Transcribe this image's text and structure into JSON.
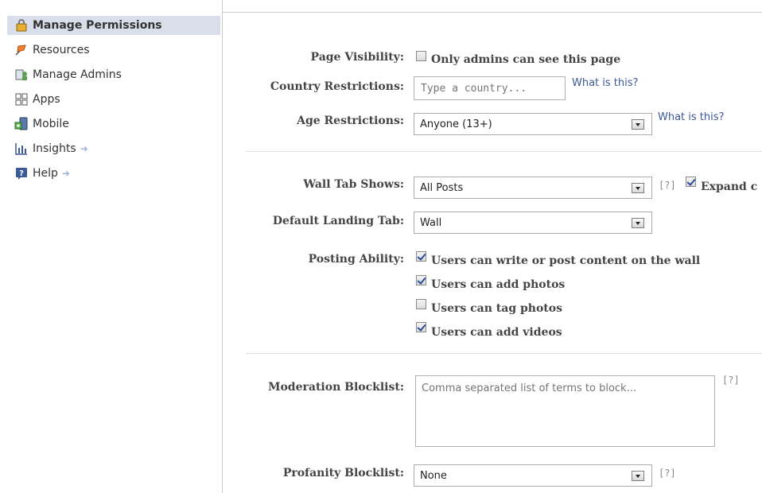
{
  "sidebar": {
    "items": [
      {
        "label": "Manage Permissions",
        "icon": "lock-icon"
      },
      {
        "label": "Resources",
        "icon": "flag-icon"
      },
      {
        "label": "Manage Admins",
        "icon": "admins-icon"
      },
      {
        "label": "Apps",
        "icon": "apps-icon"
      },
      {
        "label": "Mobile",
        "icon": "mobile-icon"
      },
      {
        "label": "Insights",
        "icon": "chart-icon",
        "arrow": "➜"
      },
      {
        "label": "Help",
        "icon": "help-icon",
        "arrow": "➜"
      }
    ]
  },
  "form": {
    "page_visibility": {
      "label": "Page Visibility:",
      "option": "Only admins can see this page",
      "checked": false
    },
    "country_restrictions": {
      "label": "Country Restrictions:",
      "placeholder": "Type a country...",
      "link": "What is this?"
    },
    "age_restrictions": {
      "label": "Age Restrictions:",
      "value": "Anyone (13+)",
      "link": "What is this?"
    },
    "wall_tab_shows": {
      "label": "Wall Tab Shows:",
      "value": "All Posts",
      "help": "[?]",
      "expand_label": "Expand c",
      "expand_checked": true
    },
    "default_landing_tab": {
      "label": "Default Landing Tab:",
      "value": "Wall"
    },
    "posting_ability": {
      "label": "Posting Ability:",
      "options": [
        {
          "label": "Users can write or post content on the wall",
          "checked": true
        },
        {
          "label": "Users can add photos",
          "checked": true
        },
        {
          "label": "Users can tag photos",
          "checked": false
        },
        {
          "label": "Users can add videos",
          "checked": true
        }
      ]
    },
    "moderation_blocklist": {
      "label": "Moderation Blocklist:",
      "placeholder": "Comma separated list of terms to block...",
      "help": "[?]"
    },
    "profanity_blocklist": {
      "label": "Profanity Blocklist:",
      "value": "None",
      "help": "[?]"
    }
  },
  "colors": {
    "active_bg": "#d8dfea",
    "link": "#3b5998",
    "checkmark": "#2a4a9a"
  }
}
